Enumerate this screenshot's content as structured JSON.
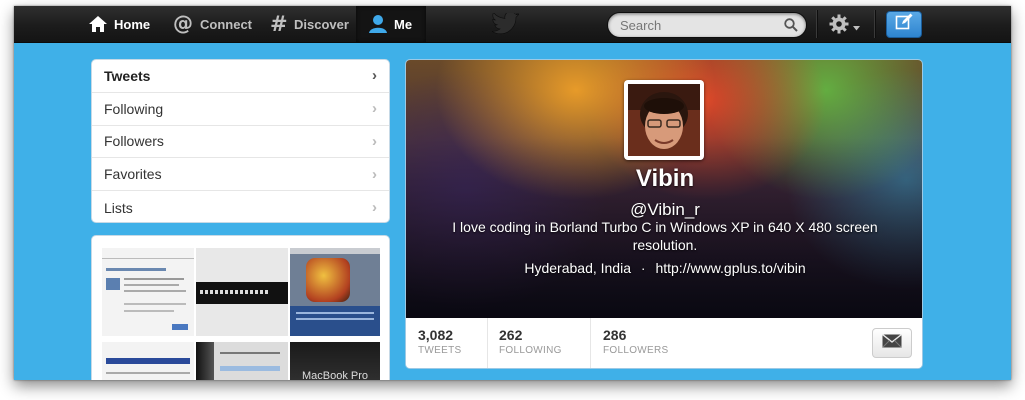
{
  "nav": {
    "home": "Home",
    "connect": "Connect",
    "discover": "Discover",
    "me": "Me"
  },
  "search": {
    "placeholder": "Search"
  },
  "sidebar": {
    "items": [
      {
        "label": "Tweets",
        "active": true
      },
      {
        "label": "Following"
      },
      {
        "label": "Followers"
      },
      {
        "label": "Favorites"
      },
      {
        "label": "Lists"
      }
    ]
  },
  "media_thumbs": {
    "macbook_caption": "MacBook Pro"
  },
  "profile": {
    "name": "Vibin",
    "handle": "@Vibin_r",
    "bio": "I love coding in Borland Turbo C in Windows XP in 640 X 480 screen resolution.",
    "location": "Hyderabad, India",
    "separator": "·",
    "url": "http://www.gplus.to/vibin"
  },
  "stats": {
    "tweets": {
      "value": "3,082",
      "label": "TWEETS"
    },
    "following": {
      "value": "262",
      "label": "FOLLOWING"
    },
    "followers": {
      "value": "286",
      "label": "FOLLOWERS"
    }
  },
  "colors": {
    "page_bg": "#3fb0e8",
    "topbar": "#1c1c1c",
    "compose": "#2e84cf"
  }
}
